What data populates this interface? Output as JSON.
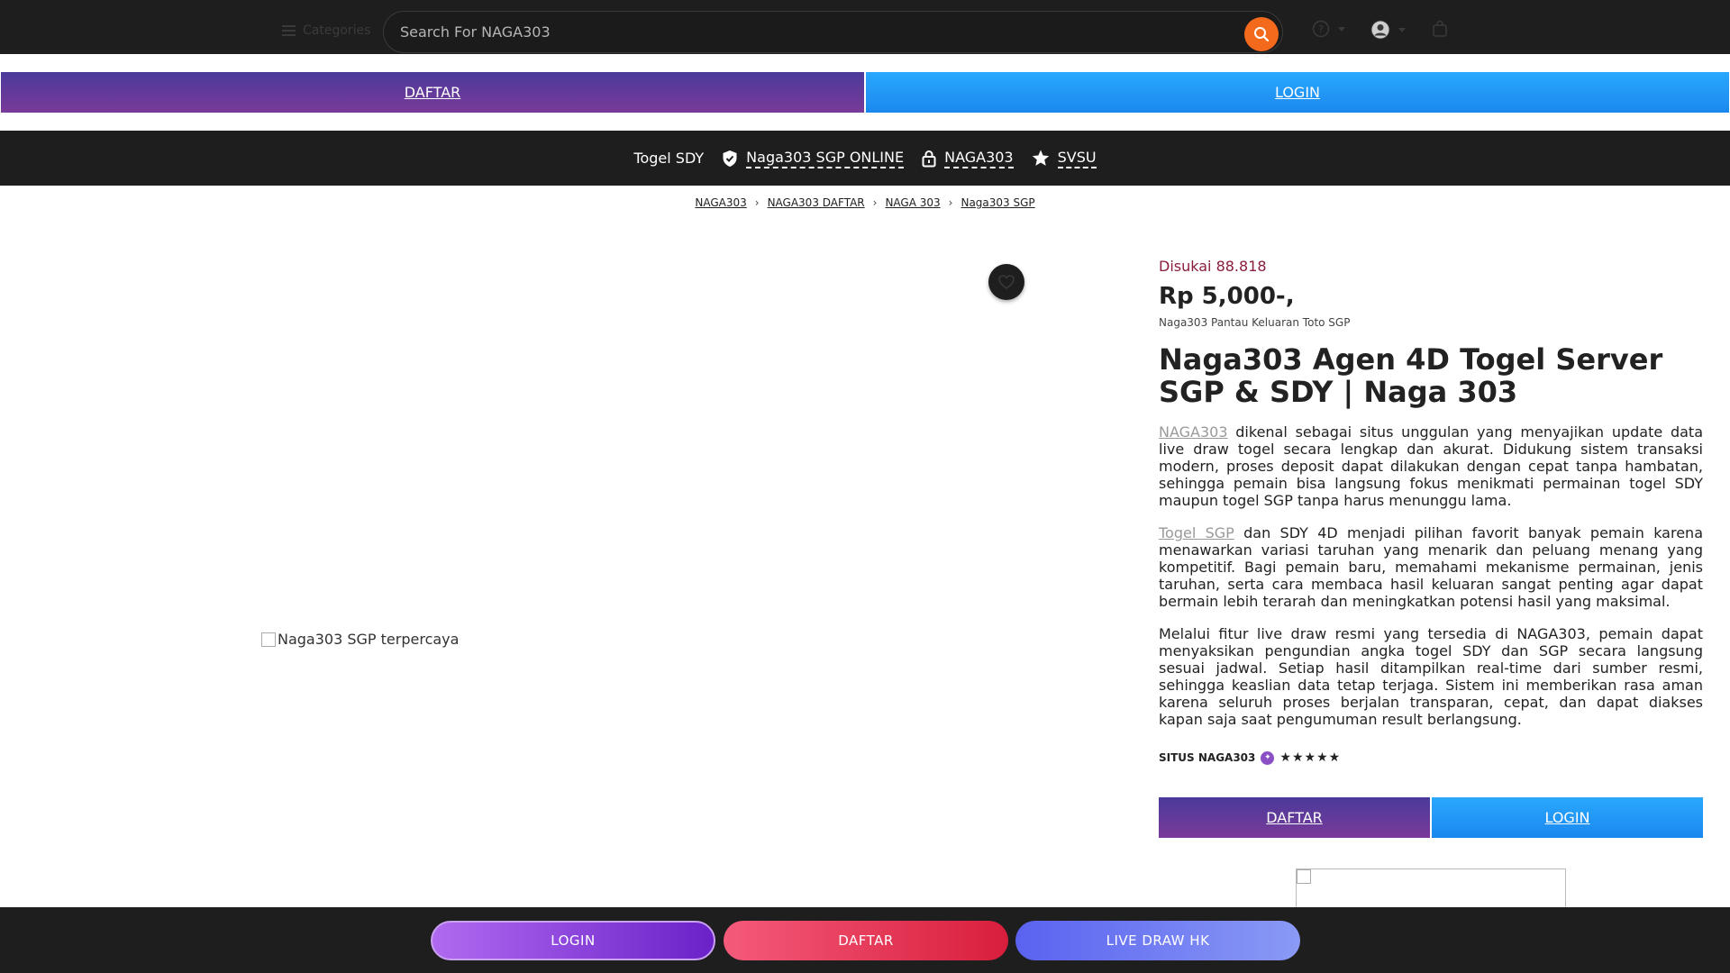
{
  "header": {
    "categories_label": "Categories",
    "search_placeholder": "Search For NAGA303"
  },
  "top_buttons": {
    "daftar": "DAFTAR",
    "login": "LOGIN"
  },
  "nav": {
    "items": [
      "Togel SDY",
      "Naga303 SGP ONLINE",
      "NAGA303",
      "SVSU"
    ]
  },
  "breadcrumb": [
    "NAGA303",
    "NAGA303 DAFTAR",
    "NAGA 303",
    "Naga303 SGP"
  ],
  "product": {
    "image_alt": "Naga303 SGP terpercaya",
    "likes": "Disukai 88.818",
    "price": "Rp 5,000-,",
    "subtitle": "Naga303 Pantau Keluaran Toto SGP",
    "title": "Naga303 Agen 4D Togel Server SGP & SDY | Naga 303",
    "para1_link": "NAGA303",
    "para1_text": " dikenal sebagai situs unggulan yang menyajikan update data live draw togel secara lengkap dan akurat. Didukung sistem transaksi modern, proses deposit dapat dilakukan dengan cepat tanpa hambatan, sehingga pemain bisa langsung fokus menikmati permainan togel SDY maupun togel SGP tanpa harus menunggu lama.",
    "para2_link": "Togel SGP",
    "para2_text": " dan SDY 4D menjadi pilihan favorit banyak pemain karena menawarkan variasi taruhan yang menarik dan peluang menang yang kompetitif. Bagi pemain baru, memahami mekanisme permainan, jenis taruhan, serta cara membaca hasil keluaran sangat penting agar dapat bermain lebih terarah dan meningkatkan potensi hasil yang maksimal.",
    "para3_text": "Melalui fitur live draw resmi yang tersedia di NAGA303, pemain dapat menyaksikan pengundian angka togel SDY dan SGP secara langsung sesuai jadwal. Setiap hasil ditampilkan real-time dari sumber resmi, sehingga keaslian data tetap terjaga. Sistem ini memberikan rasa aman karena seluruh proses berjalan transparan, cepat, dan dapat diakses kapan saja saat pengumuman result berlangsung.",
    "store_name": "SITUS NAGA303",
    "rating_stars": 5,
    "btn_daftar": "DAFTAR",
    "btn_login": "LOGIN"
  },
  "bottom_bar": {
    "login": "LOGIN",
    "daftar": "DAFTAR",
    "live": "LIVE DRAW HK"
  },
  "colors": {
    "dark": "#1e1e1e",
    "search_accent": "#f46a1c",
    "likes": "#8a1d3c",
    "purple": "#7a3a9a",
    "blue": "#1a88ee"
  },
  "icons": [
    "menu-icon",
    "search-icon",
    "help-icon",
    "user-icon",
    "bag-icon",
    "shield-check-icon",
    "lock-icon",
    "star-icon",
    "heart-icon",
    "chevron-right-icon",
    "verified-badge-icon"
  ]
}
